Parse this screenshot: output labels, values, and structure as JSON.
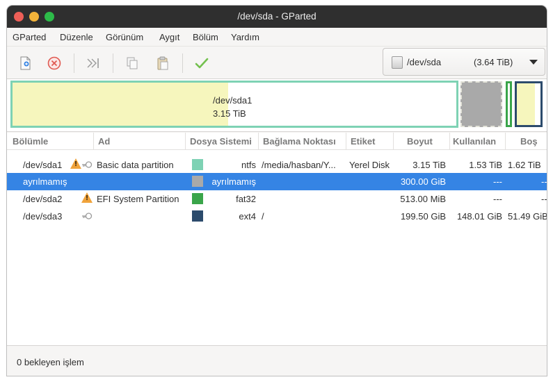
{
  "window": {
    "title": "/dev/sda - GParted"
  },
  "menu": [
    "GParted",
    "Düzenle",
    "Görünüm",
    "Aygıt",
    "Bölüm",
    "Yardım"
  ],
  "toolbar": {
    "icons": [
      "new-partition-icon",
      "delete-icon",
      "resize-move-icon",
      "copy-icon",
      "paste-icon",
      "apply-icon"
    ]
  },
  "device": {
    "name": "/dev/sda",
    "size": "(3.64 TiB)"
  },
  "diskmap": {
    "sda1_name": "/dev/sda1",
    "sda1_size": "3.15 TiB"
  },
  "table": {
    "headers": [
      "Bölümle",
      "Ad",
      "Dosya Sistemi",
      "Bağlama Noktası",
      "Etiket",
      "Boyut",
      "Kullanılan",
      "Boş"
    ],
    "rows": [
      {
        "partition": "/dev/sda1",
        "name": "Basic data partition",
        "fs_color": "#7ed2b4",
        "filesystem": "ntfs",
        "mount": "/media/hasban/Y...",
        "label": "Yerel Disk",
        "size": "3.15 TiB",
        "used": "1.53 TiB",
        "free": "1.62 TiB",
        "warning": true,
        "key": true,
        "selected": false
      },
      {
        "partition": "ayrılmamış",
        "name": "",
        "fs_color": "#a9a9a9",
        "filesystem": "ayrılmamış",
        "mount": "",
        "label": "",
        "size": "300.00 GiB",
        "used": "---",
        "free": "---",
        "warning": false,
        "key": false,
        "selected": true
      },
      {
        "partition": "/dev/sda2",
        "name": "EFI System Partition",
        "fs_color": "#3aa54a",
        "filesystem": "fat32",
        "mount": "",
        "label": "",
        "size": "513.00 MiB",
        "used": "---",
        "free": "---",
        "warning": true,
        "key": false,
        "selected": false
      },
      {
        "partition": "/dev/sda3",
        "name": "",
        "fs_color": "#2c4b6c",
        "filesystem": "ext4",
        "mount": "/",
        "label": "",
        "size": "199.50 GiB",
        "used": "148.01 GiB",
        "free": "51.49 GiB",
        "warning": false,
        "key": true,
        "selected": false
      }
    ]
  },
  "status": {
    "text": "0 bekleyen işlem"
  },
  "colors": {
    "selection": "#3584e4",
    "ntfs": "#7ed2b4",
    "fat32": "#3aa54a",
    "ext4": "#2c4b6c",
    "unallocated": "#a9a9a9",
    "used_fill": "#f6f6bd"
  }
}
